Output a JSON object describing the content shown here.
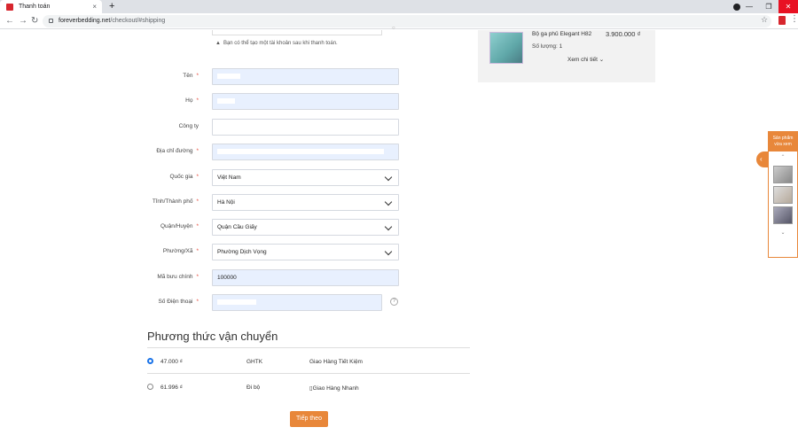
{
  "browser": {
    "tab_title": "Thanh toán",
    "tab_close": "×",
    "new_tab": "+",
    "url_host": "foreverbedding.net",
    "url_path": "/checkout/#shipping",
    "window_controls": [
      "—",
      "❐",
      "✕"
    ]
  },
  "form": {
    "account_note": "Bạn có thể tạo một tài khoản sau khi thanh toán.",
    "required_mark": "*",
    "fields": [
      {
        "label": "Tên",
        "required": true,
        "value": "",
        "type": "text",
        "filled": true
      },
      {
        "label": "Họ",
        "required": true,
        "value": "",
        "type": "text",
        "filled": true
      },
      {
        "label": "Công ty",
        "required": false,
        "value": "",
        "type": "text",
        "filled": false
      },
      {
        "label": "Địa chỉ đường",
        "required": true,
        "value": "",
        "type": "text",
        "filled": true
      },
      {
        "label": "Quốc gia",
        "required": true,
        "value": "Việt Nam",
        "type": "select",
        "filled": false
      },
      {
        "label": "Tỉnh/Thành phố",
        "required": true,
        "value": "Hà Nội",
        "type": "select",
        "filled": false
      },
      {
        "label": "Quận/Huyện",
        "required": true,
        "value": "Quận Cầu Giấy",
        "type": "select",
        "filled": false
      },
      {
        "label": "Phường/Xã",
        "required": true,
        "value": "Phường Dịch Vọng",
        "type": "select",
        "filled": false
      },
      {
        "label": "Mã bưu chính",
        "required": true,
        "value": "100000",
        "type": "text",
        "filled": true
      },
      {
        "label": "Số Điện thoại",
        "required": true,
        "value": "",
        "type": "text",
        "filled": true
      }
    ],
    "help_icon": "?"
  },
  "shipping": {
    "title": "Phương thức vận chuyển",
    "methods": [
      {
        "price": "47.000 ₫",
        "carrier": "GHTK",
        "service": "Giao Hàng Tiết Kiệm",
        "selected": true
      },
      {
        "price": "61.996 ₫",
        "carrier": "Đi bộ",
        "service": "Giao Hàng Nhanh",
        "selected": false
      }
    ]
  },
  "next_button": "Tiếp theo",
  "summary": {
    "product_name": "Bộ ga phủ Elegant H82",
    "product_price": "3.900.000 ₫",
    "quantity_label": "Số lượng: 1",
    "details_link": "Xem chi tiết"
  },
  "side_widget": {
    "title": "Sản phẩm vừa xem",
    "toggle": "‹",
    "up": "⌃",
    "down": "⌄"
  },
  "colors": {
    "accent": "#e8873a",
    "required": "#e74c3c",
    "autofill_bg": "#e8f0fe"
  }
}
